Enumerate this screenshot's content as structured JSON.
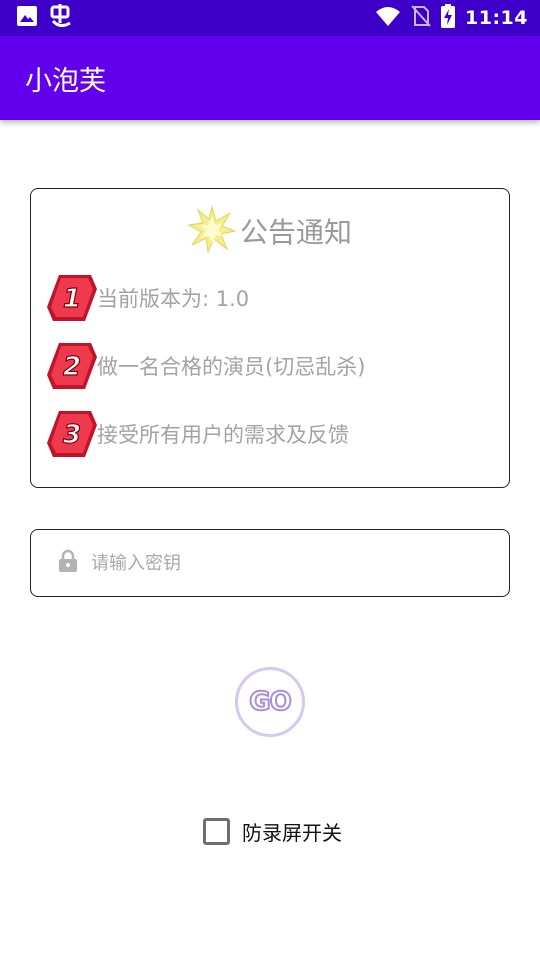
{
  "status_bar": {
    "time": "11:14",
    "left_icons": [
      "image-icon",
      "bug-app-icon"
    ],
    "right_icons": [
      "wifi-icon",
      "no-sim-icon",
      "battery-charging-icon"
    ]
  },
  "app_bar": {
    "title": "小泡芙"
  },
  "notice": {
    "title": "公告通知",
    "header_icon": "starburst-icon",
    "items": [
      {
        "number": "1",
        "text": "当前版本为: 1.0"
      },
      {
        "number": "2",
        "text": "做一名合格的演员(切忌乱杀)"
      },
      {
        "number": "3",
        "text": "接受所有用户的需求及反馈"
      }
    ]
  },
  "key_field": {
    "placeholder": "请输入密钥",
    "value": "",
    "icon": "lock-icon"
  },
  "go_button": {
    "label": "GO"
  },
  "record_toggle": {
    "label": "防录屏开关",
    "checked": false
  },
  "colors": {
    "status_bar": "#3e00c8",
    "app_bar": "#6200ee",
    "badge_red": "#e8283c",
    "muted_text": "#a3a3a3"
  }
}
